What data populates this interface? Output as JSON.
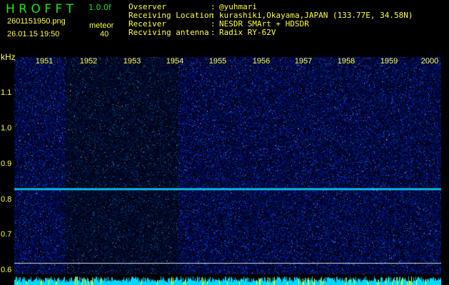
{
  "header": {
    "logo": "H R O F F T",
    "version": "1.0.0f",
    "filename": "2601151950.png",
    "datetime": "26.01.15 19:50",
    "mode_label": "meteor",
    "count": "40"
  },
  "info": [
    {
      "label": "Ovserver",
      "value": "@yuhmari"
    },
    {
      "label": "Receiving Location",
      "value": "kurashiki,Okayama,JAPAN (133.77E, 34.58N)"
    },
    {
      "label": "Receiver",
      "value": "NESDR SMArt + HDSDR"
    },
    {
      "label": "Recviving antenna",
      "value": "Radix RY-62V"
    }
  ],
  "axis": {
    "unit": "kHz",
    "y_ticks": [
      "1.1",
      "1.0",
      "0.9",
      "0.8",
      "0.7",
      "0.6"
    ],
    "minutes": [
      "1951",
      "1952",
      "1953",
      "1954",
      "1955",
      "1956",
      "1957",
      "1958",
      "1959",
      "2000"
    ]
  }
}
